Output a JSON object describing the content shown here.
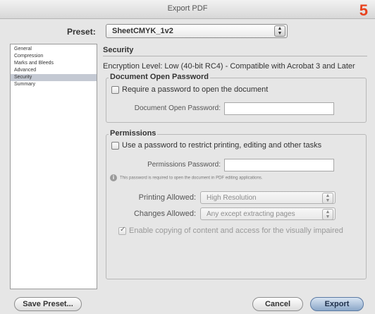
{
  "window": {
    "title": "Export PDF",
    "step_number": "5"
  },
  "preset": {
    "label": "Preset:",
    "value": "SheetCMYK_1v2"
  },
  "sidebar": {
    "items": [
      {
        "label": "General"
      },
      {
        "label": "Compression"
      },
      {
        "label": "Marks and Bleeds"
      },
      {
        "label": "Advanced"
      },
      {
        "label": "Security",
        "selected": true
      },
      {
        "label": "Summary"
      }
    ]
  },
  "security": {
    "header": "Security",
    "encryption_level": "Encryption Level: Low (40-bit RC4) - Compatible with Acrobat 3 and Later",
    "open_password": {
      "title": "Document Open Password",
      "checkbox_label": "Require a password to open the document",
      "checked": false,
      "field_label": "Document Open Password:",
      "field_value": ""
    },
    "permissions": {
      "title": "Permissions",
      "checkbox_label": "Use a password to restrict printing, editing and other tasks",
      "checked": false,
      "field_label": "Permissions Password:",
      "field_value": "",
      "info_text": "This password is required to open the document in PDF editing applications.",
      "printing_label": "Printing Allowed:",
      "printing_value": "High Resolution",
      "changes_label": "Changes Allowed:",
      "changes_value": "Any except extracting pages",
      "copy_checkbox_label": "Enable copying of content and access for the visually impaired",
      "copy_checked": true
    }
  },
  "buttons": {
    "save_preset": "Save Preset...",
    "cancel": "Cancel",
    "export": "Export"
  },
  "icons": {
    "stepper": "up-down-arrows-icon",
    "info": "info-icon",
    "check": "checkmark-icon"
  }
}
